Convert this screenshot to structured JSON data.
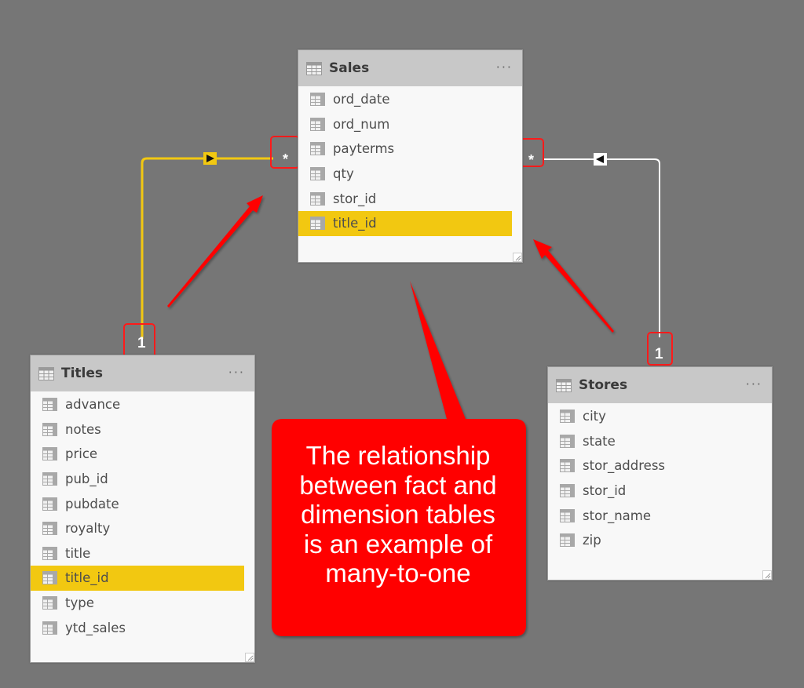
{
  "diagram": {
    "type": "data-model-relationship-view",
    "tables": {
      "sales": {
        "name": "Sales",
        "more_label": "···",
        "fields": [
          "ord_date",
          "ord_num",
          "payterms",
          "qty",
          "stor_id",
          "title_id"
        ],
        "highlighted_field": "title_id"
      },
      "titles": {
        "name": "Titles",
        "more_label": "···",
        "fields": [
          "advance",
          "notes",
          "price",
          "pub_id",
          "pubdate",
          "royalty",
          "title",
          "title_id",
          "type",
          "ytd_sales"
        ],
        "highlighted_field": "title_id"
      },
      "stores": {
        "name": "Stores",
        "more_label": "···",
        "fields": [
          "city",
          "state",
          "stor_address",
          "stor_id",
          "stor_name",
          "zip"
        ],
        "highlighted_field": null
      }
    },
    "relationships": [
      {
        "from_table": "Titles",
        "to_table": "Sales",
        "from_cardinality": "1",
        "to_cardinality": "*",
        "key": "title_id",
        "selected": true,
        "color": "#f2c811",
        "filter_direction": "single"
      },
      {
        "from_table": "Stores",
        "to_table": "Sales",
        "from_cardinality": "1",
        "to_cardinality": "*",
        "key": "stor_id",
        "selected": false,
        "color": "#ffffff",
        "filter_direction": "single"
      }
    ],
    "callout": {
      "lines": [
        "The relationship",
        "between fact and",
        "dimension tables",
        "is an example of",
        "many-to-one"
      ],
      "background": "#ff0000",
      "text_color": "#ffffff"
    },
    "colors": {
      "canvas": "#767676",
      "header": "#c8c8c8",
      "card": "#f8f8f8",
      "highlight": "#f2c811",
      "annotation": "#ff0000"
    }
  }
}
